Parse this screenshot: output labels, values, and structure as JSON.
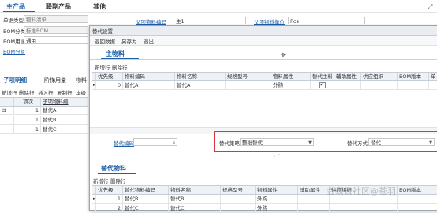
{
  "main_tabs": [
    "主产品",
    "联副产品",
    "其他"
  ],
  "header_form": {
    "doc_type_label": "单据类型",
    "doc_type_value": "物料清单",
    "bom_class_label": "BOM分类",
    "bom_class_value": "标准BOM",
    "bom_use_label": "BOM用途",
    "bom_use_value": "通用",
    "bom_group_label": "BOM分组",
    "parent_code_label": "父项物料编码",
    "parent_code_value": "主1",
    "parent_unit_label": "父项物料单位",
    "parent_unit_value": "Pcs"
  },
  "left_tabs": [
    "子项明细",
    "阶梯用量",
    "物料"
  ],
  "left_toolbar": [
    "新增行",
    "删除行",
    "插入行",
    "复制行",
    "本级"
  ],
  "left_grid": {
    "col_seq": "项次",
    "col_child": "子项物料编",
    "rows": [
      {
        "seq": "1",
        "name": "替代A"
      },
      {
        "seq": "1",
        "name": "替代B"
      },
      {
        "seq": "1",
        "name": "替代C"
      }
    ]
  },
  "dialog": {
    "title": "替代设置",
    "toolbar": [
      "返回数据",
      "另存为",
      "退出"
    ],
    "main_section": "主物料",
    "main_toolbar": [
      "新增行",
      "删除行"
    ],
    "main_columns": [
      "优先级",
      "物料编码",
      "物料名称",
      "规格型号",
      "物料属性",
      "替代主料",
      "辅助属性",
      "供应组织",
      "BOM版本",
      "单"
    ],
    "main_rows": [
      {
        "priority": "0",
        "code": "替代A",
        "name": "替代A",
        "attr": "外购"
      }
    ],
    "sub_code_label": "替代编码",
    "strategy_label": "替代策略",
    "strategy_value": "整批替代",
    "method_label": "替代方式",
    "method_value": "替代",
    "sub_section": "替代物料",
    "sub_toolbar": [
      "新增行",
      "删除行"
    ],
    "sub_columns": [
      "优先级",
      "替代物料编码",
      "物料名称",
      "规格型号",
      "物料属性",
      "辅助属性",
      "供应组织",
      "BOM版本"
    ],
    "sub_rows": [
      {
        "priority": "1",
        "code": "替代B",
        "name": "替代B",
        "attr": "外购"
      },
      {
        "priority": "2",
        "code": "替代C",
        "name": "替代C",
        "attr": "外购"
      }
    ]
  },
  "watermark": "金蝶云社区@苍羽"
}
